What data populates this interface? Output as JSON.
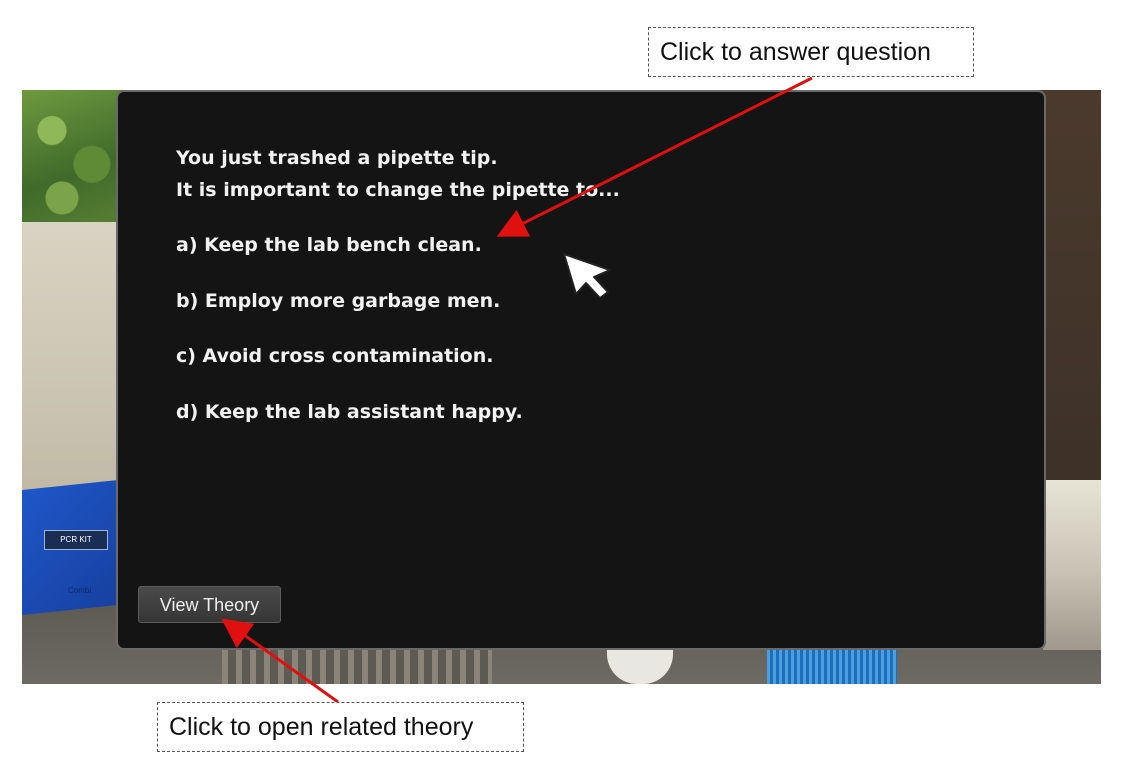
{
  "dialog": {
    "question_line_1": "You just trashed a pipette tip.",
    "question_line_2": "It is important to change the pipette to...",
    "answers": [
      "a) Keep the lab bench clean.",
      "b) Employ more garbage men.",
      "c) Avoid cross contamination.",
      "d) Keep the lab assistant happy."
    ],
    "view_theory_label": "View Theory"
  },
  "scene": {
    "pcr_box_label": "PCR KIT",
    "pcr_box_sublabel": "Combi"
  },
  "annotations": {
    "answer_hint": "Click to answer question",
    "theory_hint": "Click to open related theory",
    "arrow_color": "#e01010"
  },
  "icons": {
    "pointer": "mouse-pointer-icon"
  }
}
